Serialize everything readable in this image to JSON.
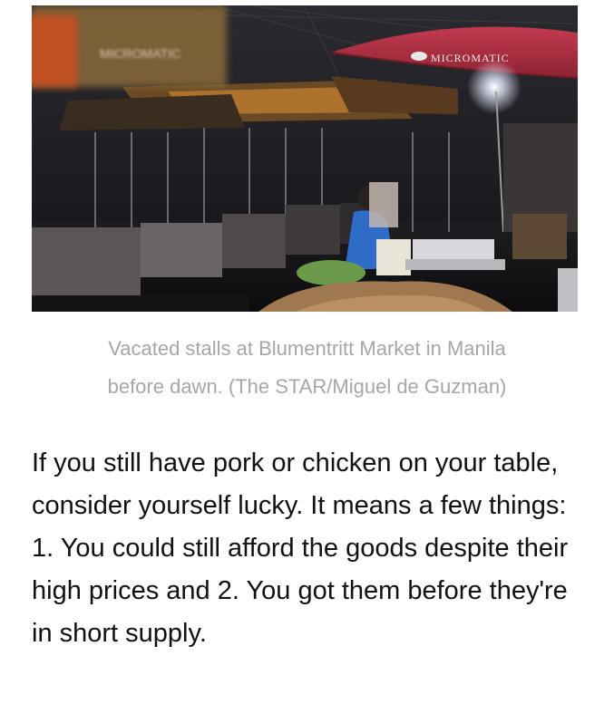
{
  "article": {
    "photo": {
      "umbrella_brand": "MICROMATIC",
      "blurred_sign": "MICROMATIC"
    },
    "caption": {
      "line1": "Vacated stalls at Blumentritt Market in Manila",
      "line2": "before dawn. (The STAR/Miguel de Guzman)"
    },
    "body": "If you still have pork or chicken on your table, consider yourself lucky. It means a few things: 1. You could still afford the goods despite their high prices and 2. You got them before they're in short supply."
  }
}
